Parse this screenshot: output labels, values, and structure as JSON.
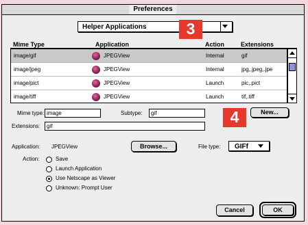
{
  "window": {
    "title": "Preferences"
  },
  "category_popup": {
    "selected": "Helper Applications"
  },
  "badges": {
    "first": "3",
    "second": "4"
  },
  "table": {
    "headers": [
      "Mime Type",
      "Application",
      "Action",
      "Extensions"
    ],
    "rows": [
      {
        "mime": "image/gif",
        "app": "JPEGView",
        "action": "Internal",
        "ext": "gif"
      },
      {
        "mime": "image/jpeg",
        "app": "JPEGView",
        "action": "Internal",
        "ext": "jpg,.jpeg,.jpe"
      },
      {
        "mime": "image/pict",
        "app": "JPEGView",
        "action": "Launch",
        "ext": "pic,.pict"
      },
      {
        "mime": "image/tiff",
        "app": "JPEGView",
        "action": "Launch",
        "ext": "tif,.tiff"
      }
    ]
  },
  "form": {
    "mime_type_label": "Mime type:",
    "mime_type_value": "image",
    "subtype_label": "Subtype:",
    "subtype_value": "gif",
    "extensions_label": "Extensions:",
    "extensions_value": "gif",
    "new_button": "New...",
    "application_label": "Application:",
    "application_value": "JPEGView",
    "browse_button": "Browse...",
    "file_type_label": "File type:",
    "file_type_value": "GIFf",
    "action_label": "Action:",
    "actions": [
      "Save",
      "Launch Application",
      "Use Netscape as Viewer",
      "Unknown: Prompt User"
    ],
    "selected_action": "Use Netscape as Viewer"
  },
  "buttons": {
    "cancel": "Cancel",
    "ok": "OK"
  },
  "colors": {
    "badge": "#e4392c",
    "selection": "#c9c9c9",
    "scroll_thumb": "#8f8fe0",
    "page_bg": "#f2d9de"
  }
}
